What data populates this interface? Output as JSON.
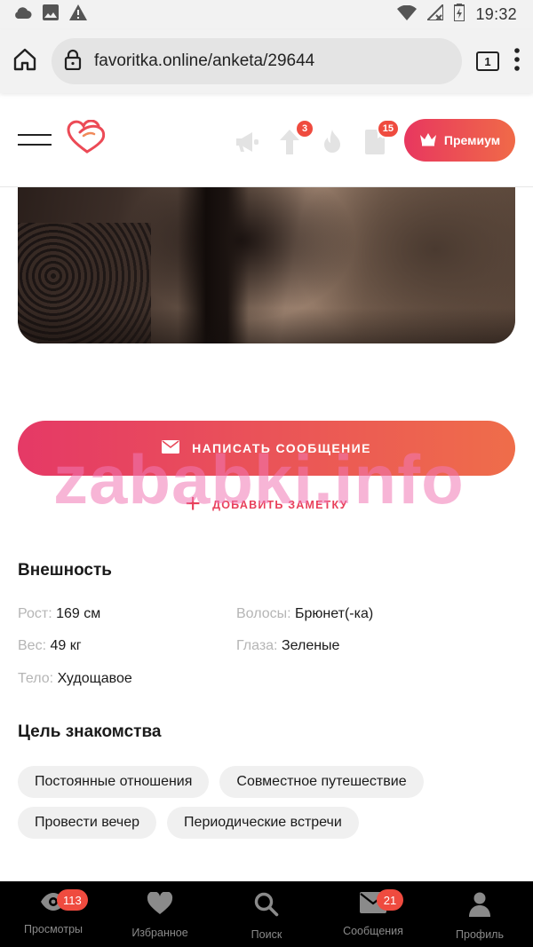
{
  "status_bar": {
    "time": "19:32",
    "left_icons": [
      "cloud-icon",
      "image-icon",
      "warning-icon"
    ],
    "right_icons": [
      "wifi-icon",
      "no-signal-icon",
      "battery-charging-icon"
    ]
  },
  "browser": {
    "url": "favoritka.online/anketa/29644",
    "tab_count": "1"
  },
  "header": {
    "badges": {
      "boost": "3",
      "likes": "15"
    },
    "premium_label": "Премиум"
  },
  "actions": {
    "message_label": "НАПИСАТЬ СООБЩЕНИЕ",
    "note_label": "ДОБАВИТЬ ЗАМЕТКУ"
  },
  "watermark": "zababki.info",
  "appearance": {
    "title": "Внешность",
    "height_label": "Рост:",
    "height_value": "169 см",
    "weight_label": "Вес:",
    "weight_value": "49 кг",
    "body_label": "Тело:",
    "body_value": "Худощавое",
    "hair_label": "Волосы:",
    "hair_value": "Брюнет(-ка)",
    "eyes_label": "Глаза:",
    "eyes_value": "Зеленые"
  },
  "goal": {
    "title": "Цель знакомства",
    "chips": [
      "Постоянные отношения",
      "Совместное путешествие",
      "Провести вечер",
      "Периодические встречи"
    ]
  },
  "bottom_nav": {
    "items": [
      {
        "label": "Просмотры",
        "badge": "113"
      },
      {
        "label": "Избранное"
      },
      {
        "label": "Поиск"
      },
      {
        "label": "Сообщения",
        "badge": "21"
      },
      {
        "label": "Профиль"
      }
    ]
  },
  "colors": {
    "accent_start": "#e53966",
    "accent_end": "#ef6d4a",
    "badge": "#ef4b3f"
  }
}
